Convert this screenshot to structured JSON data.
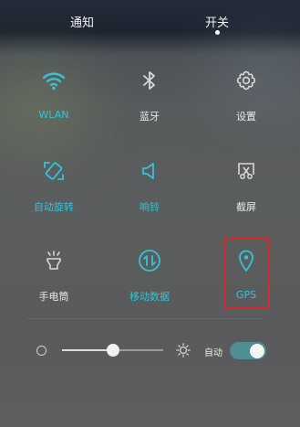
{
  "tabs": [
    {
      "label": "通知",
      "selected": false
    },
    {
      "label": "开关",
      "selected": true
    }
  ],
  "tiles": [
    {
      "label": "WLAN",
      "icon": "wifi-icon",
      "active": true
    },
    {
      "label": "蓝牙",
      "icon": "bluetooth-icon",
      "active": false
    },
    {
      "label": "设置",
      "icon": "gear-icon",
      "active": false
    },
    {
      "label": "自动旋转",
      "icon": "rotate-icon",
      "active": true
    },
    {
      "label": "响铃",
      "icon": "speaker-icon",
      "active": true
    },
    {
      "label": "截屏",
      "icon": "screenshot-icon",
      "active": false
    },
    {
      "label": "手电筒",
      "icon": "flashlight-icon",
      "active": false
    },
    {
      "label": "移动数据",
      "icon": "mobile-data-icon",
      "active": true
    },
    {
      "label": "GPS",
      "icon": "location-pin-icon",
      "active": true
    }
  ],
  "brightness": {
    "level": 0.5,
    "auto_label": "自动",
    "auto_enabled": true
  },
  "colors": {
    "accent": "#35c3d8",
    "inactive": "#d8d8d8",
    "highlight_frame": "#d8282c",
    "toggle_on": "#4f8e92"
  }
}
